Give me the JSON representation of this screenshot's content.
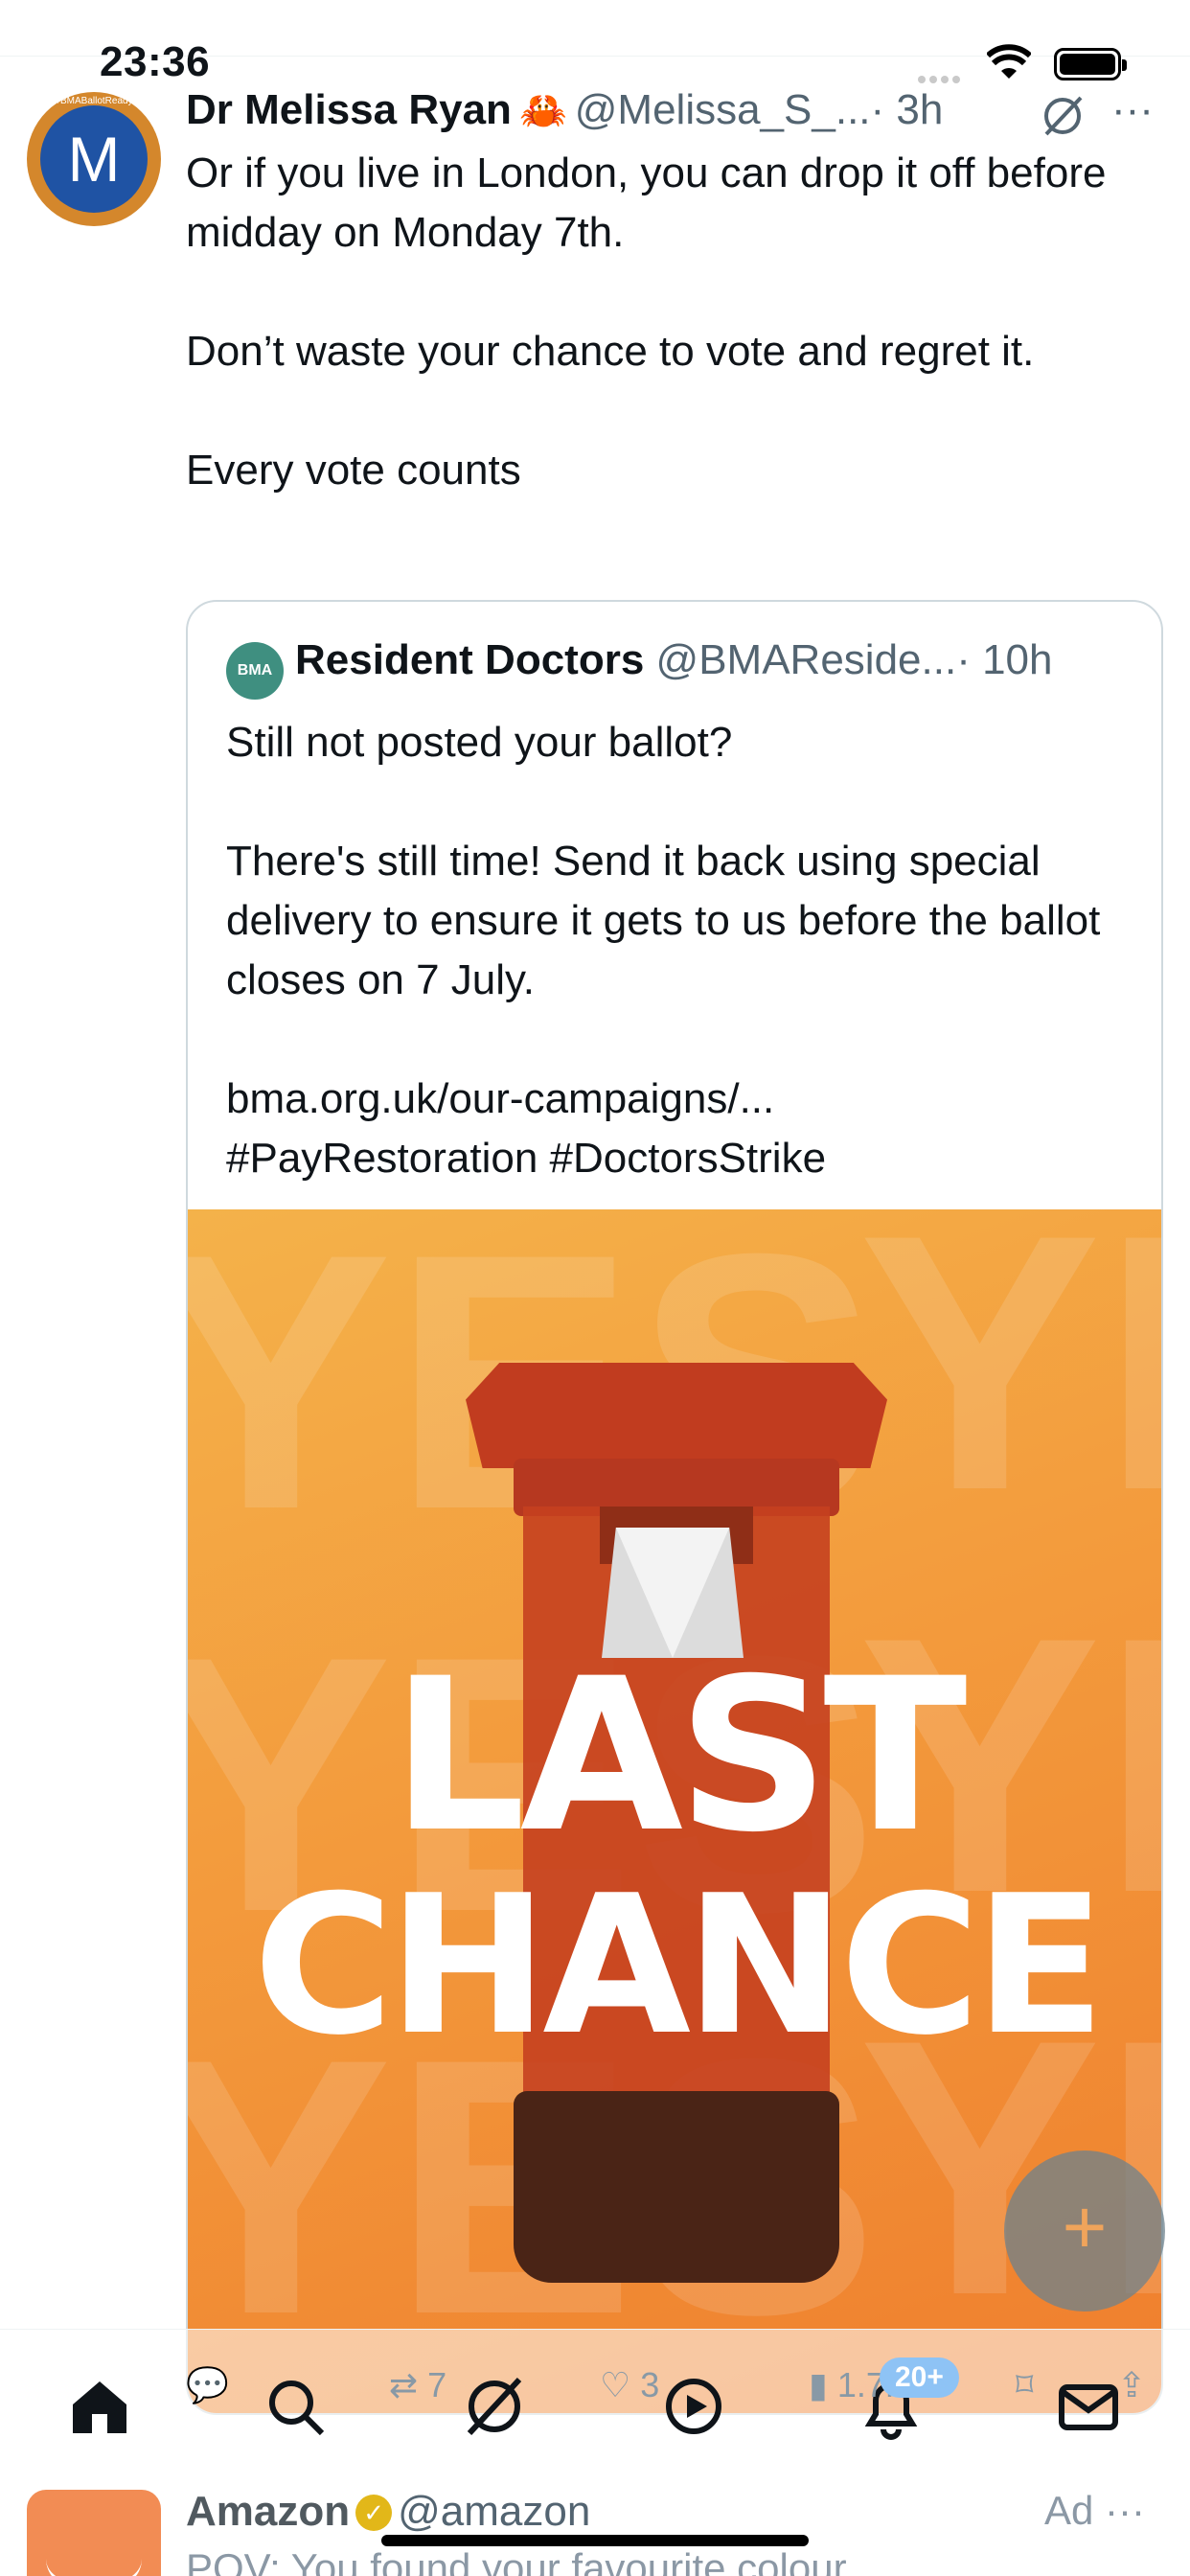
{
  "status_bar": {
    "time": "23:36"
  },
  "tweet": {
    "avatar_letter": "M",
    "avatar_ring_text": "#BMABallotReady",
    "author_name": "Dr Melissa Ryan",
    "author_emoji": "🦀",
    "handle": "@Melissa_S_...",
    "age": "· 3h",
    "more": "···",
    "lines": [
      "Or if you live in London, you can drop it off before midday on Monday 7th.",
      "Don’t waste your chance to vote and regret it.",
      "Every vote counts"
    ]
  },
  "quote": {
    "avatar_text": "BMA",
    "name": "Resident Doctors",
    "handle": "@BMAReside...",
    "age": "· 10h",
    "lines": [
      "Still not posted your ballot?",
      "There's still time! Send it back using special delivery to ensure it gets to us before the ballot closes on 7 July.",
      "bma.org.uk/our-campaigns/...",
      "#PayRestoration #DoctorsStrike"
    ],
    "media": {
      "headline_1": "LAST",
      "headline_2": "CHANCE",
      "background_word": "YES"
    }
  },
  "actions": {
    "reply_count": "",
    "retweet_count": "7",
    "like_count": "3",
    "views_count": "1.7K",
    "notifications_badge": "20+"
  },
  "fab": {
    "label": "+"
  },
  "ad": {
    "name": "Amazon",
    "handle": "@amazon",
    "label": "Ad",
    "more": "···",
    "text": "POV: You found your favourite colour"
  },
  "colors": {
    "accent": "#1d9bf0",
    "media_orange": "#f39a3c",
    "postbox_red": "#c5401f"
  }
}
